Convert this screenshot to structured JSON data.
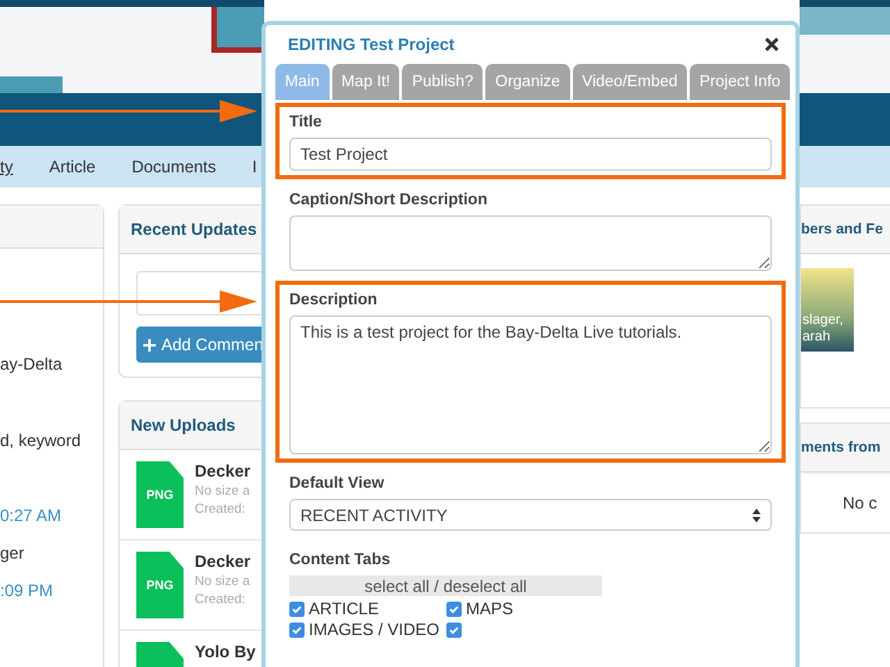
{
  "background_page": {
    "nav_items": [
      {
        "label": "ty",
        "selected": true
      },
      {
        "label": "Article",
        "selected": false
      },
      {
        "label": "Documents",
        "selected": false
      },
      {
        "label": "I",
        "selected": false
      }
    ],
    "left_panel": {
      "lines": [
        {
          "text": "ay-Delta",
          "kind": "text"
        },
        {
          "text": "d, keyword",
          "kind": "text"
        },
        {
          "text": "0:27 AM",
          "kind": "link"
        },
        {
          "text": "ger",
          "kind": "text"
        },
        {
          "text": ":09 PM",
          "kind": "link"
        }
      ]
    },
    "recent_updates": {
      "title": "Recent Updates",
      "button": "Add Commen"
    },
    "new_uploads": {
      "title": "New Uploads",
      "items": [
        {
          "badge": "PNG",
          "name": "Decker",
          "size": "No size a",
          "created": "Created:"
        },
        {
          "badge": "PNG",
          "name": "Decker",
          "size": "No size a",
          "created": "Created:"
        },
        {
          "name": "Yolo By"
        }
      ]
    },
    "members": {
      "title": "bers and Fe",
      "caption": [
        "slager,",
        "arah"
      ]
    },
    "comments": {
      "title": "ments from",
      "empty": "No c"
    }
  },
  "modal": {
    "title": "EDITING Test Project",
    "tabs": [
      {
        "label": "Main",
        "selected": true
      },
      {
        "label": "Map It!",
        "selected": false
      },
      {
        "label": "Publish?",
        "selected": false
      },
      {
        "label": "Organize",
        "selected": false
      },
      {
        "label": "Video/Embed",
        "selected": false
      },
      {
        "label": "Project Info",
        "selected": false
      }
    ],
    "title_field": {
      "label": "Title",
      "value": "Test Project",
      "highlighted": true
    },
    "caption_field": {
      "label": "Caption/Short Description"
    },
    "description_field": {
      "label": "Description",
      "value": "This is a test project for the Bay-Delta Live tutorials.",
      "highlighted": true
    },
    "default_view": {
      "label": "Default View",
      "value": "RECENT ACTIVITY"
    },
    "content_tabs": {
      "label": "Content Tabs",
      "select_all": "select all / deselect all",
      "options": [
        {
          "label": "ARTICLE",
          "checked": true
        },
        {
          "label": "MAPS",
          "checked": true
        },
        {
          "label": "IMAGES / VIDEO",
          "checked": true
        },
        {
          "checked": true
        }
      ]
    }
  }
}
